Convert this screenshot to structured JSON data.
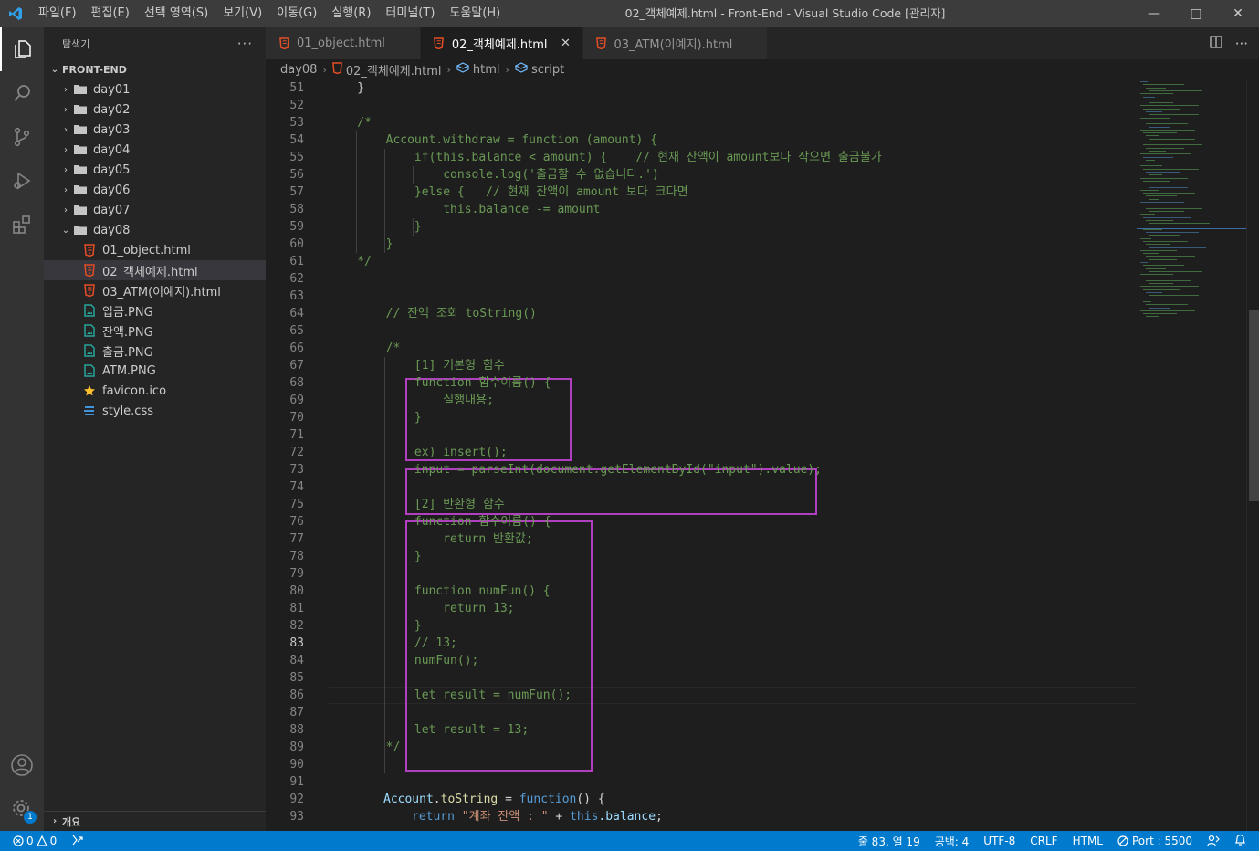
{
  "titlebar": {
    "menus": [
      "파일(F)",
      "편집(E)",
      "선택 영역(S)",
      "보기(V)",
      "이동(G)",
      "실행(R)",
      "터미널(T)",
      "도움말(H)"
    ],
    "window_title": "02_객체예제.html - Front-End - Visual Studio Code [관리자]"
  },
  "sidebar": {
    "title": "탐색기",
    "root": "FRONT-END",
    "folders": [
      "day01",
      "day02",
      "day03",
      "day04",
      "day05",
      "day06",
      "day07",
      "day08"
    ],
    "files": [
      {
        "name": "01_object.html",
        "icon": "html5-icon",
        "color": "#e44d26"
      },
      {
        "name": "02_객체예제.html",
        "icon": "html5-icon",
        "color": "#e44d26"
      },
      {
        "name": "03_ATM(이예지).html",
        "icon": "html5-icon",
        "color": "#e44d26"
      },
      {
        "name": "입금.PNG",
        "icon": "image-icon",
        "color": "#26a69a"
      },
      {
        "name": "잔액.PNG",
        "icon": "image-icon",
        "color": "#26a69a"
      },
      {
        "name": "출금.PNG",
        "icon": "image-icon",
        "color": "#26a69a"
      },
      {
        "name": "ATM.PNG",
        "icon": "image-icon",
        "color": "#26a69a"
      },
      {
        "name": "favicon.ico",
        "icon": "star-icon",
        "color": "#fbc02d"
      },
      {
        "name": "style.css",
        "icon": "css-icon",
        "color": "#42a5f5"
      }
    ],
    "outline": "개요"
  },
  "tabs": [
    {
      "label": "01_object.html",
      "active": false
    },
    {
      "label": "02_객체예제.html",
      "active": true
    },
    {
      "label": "03_ATM(이예지).html",
      "active": false
    }
  ],
  "breadcrumb": [
    "day08",
    "02_객체예제.html",
    "html",
    "script"
  ],
  "code_lines": [
    {
      "n": "51",
      "t": "    }",
      "k": "c-plain"
    },
    {
      "n": "52",
      "t": "",
      "k": "c-plain"
    },
    {
      "n": "53",
      "t": "    /*",
      "k": "c-cmt"
    },
    {
      "n": "54",
      "t": "        Account.withdraw = function (amount) {",
      "k": "c-cmt"
    },
    {
      "n": "55",
      "t": "            if(this.balance < amount) {    // 현재 잔액이 amount보다 작으면 출금불가",
      "k": "c-cmt"
    },
    {
      "n": "56",
      "t": "                console.log('출금할 수 없습니다.')",
      "k": "c-cmt"
    },
    {
      "n": "57",
      "t": "            }else {   // 현재 잔액이 amount 보다 크다면",
      "k": "c-cmt"
    },
    {
      "n": "58",
      "t": "                this.balance -= amount",
      "k": "c-cmt"
    },
    {
      "n": "59",
      "t": "            }",
      "k": "c-cmt"
    },
    {
      "n": "60",
      "t": "        }",
      "k": "c-cmt"
    },
    {
      "n": "61",
      "t": "    */",
      "k": "c-cmt"
    },
    {
      "n": "62",
      "t": "",
      "k": "c-plain"
    },
    {
      "n": "63",
      "t": "",
      "k": "c-plain"
    },
    {
      "n": "64",
      "t": "        // 잔액 조회 toString()",
      "k": "c-cmt"
    },
    {
      "n": "65",
      "t": "",
      "k": "c-plain"
    },
    {
      "n": "66",
      "t": "        /*",
      "k": "c-cmt"
    },
    {
      "n": "67",
      "t": "            [1] 기본형 함수",
      "k": "c-cmt"
    },
    {
      "n": "68",
      "t": "            function 함수이름() {",
      "k": "c-cmt"
    },
    {
      "n": "69",
      "t": "                실행내용;",
      "k": "c-cmt"
    },
    {
      "n": "70",
      "t": "            }",
      "k": "c-cmt"
    },
    {
      "n": "71",
      "t": "",
      "k": "c-cmt"
    },
    {
      "n": "72",
      "t": "            ex) insert();",
      "k": "c-cmt"
    },
    {
      "n": "73",
      "t": "            input = parseInt(document.getElementById(\"input\").value);",
      "k": "c-cmt"
    },
    {
      "n": "74",
      "t": "",
      "k": "c-cmt"
    },
    {
      "n": "75",
      "t": "            [2] 반환형 함수",
      "k": "c-cmt"
    },
    {
      "n": "76",
      "t": "            function 함수이름() {",
      "k": "c-cmt"
    },
    {
      "n": "77",
      "t": "                return 반환값;",
      "k": "c-cmt"
    },
    {
      "n": "78",
      "t": "            }",
      "k": "c-cmt"
    },
    {
      "n": "79",
      "t": "",
      "k": "c-cmt"
    },
    {
      "n": "80",
      "t": "            function numFun() {",
      "k": "c-cmt"
    },
    {
      "n": "81",
      "t": "                return 13;",
      "k": "c-cmt"
    },
    {
      "n": "82",
      "t": "            }",
      "k": "c-cmt"
    },
    {
      "n": "83",
      "t": "            // 13;",
      "k": "c-cmt"
    },
    {
      "n": "84",
      "t": "            numFun();",
      "k": "c-cmt"
    },
    {
      "n": "85",
      "t": "",
      "k": "c-cmt"
    },
    {
      "n": "86",
      "t": "            let result = numFun();",
      "k": "c-cmt"
    },
    {
      "n": "87",
      "t": "",
      "k": "c-cmt"
    },
    {
      "n": "88",
      "t": "            let result = 13;",
      "k": "c-cmt"
    },
    {
      "n": "89",
      "t": "        */",
      "k": "c-cmt"
    },
    {
      "n": "90",
      "t": "",
      "k": "c-plain"
    },
    {
      "n": "91",
      "t": "",
      "k": "c-plain"
    },
    {
      "n": "92",
      "t": "",
      "k": "c-plain"
    },
    {
      "n": "93",
      "t": "",
      "k": "c-plain"
    }
  ],
  "line92": {
    "obj": "Account",
    "dot": ".",
    "method": "toString",
    "eq": " = ",
    "fn": "function",
    "rest": "() {"
  },
  "line93": {
    "ret": "return",
    "str": "\"계좌 잔액 : \"",
    "plus": " + ",
    "this": "this",
    "prop": ".balance",
    "semi": ";"
  },
  "current_line": "83",
  "statusbar": {
    "errors": "0",
    "warnings": "0",
    "position": "줄 83, 열 19",
    "spaces": "공백: 4",
    "encoding": "UTF-8",
    "eol": "CRLF",
    "language": "HTML",
    "port": "Port : 5500"
  },
  "colors": {
    "accent": "#007acc",
    "highlight_box": "#b040c0"
  }
}
